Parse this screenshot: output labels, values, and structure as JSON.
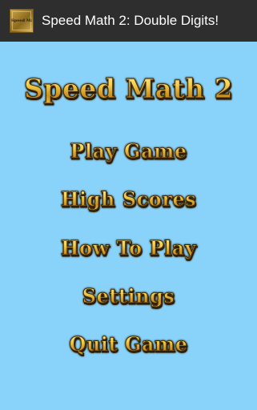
{
  "window": {
    "title": "Speed Math 2: Double Digits!",
    "icon_name": "app-icon",
    "icon_label": "Speed Math 2"
  },
  "screen": {
    "title": "Speed Math 2",
    "background_color": "#89d3fb",
    "text_color": "#f7c52c"
  },
  "menu": {
    "items": [
      {
        "label": "Play Game"
      },
      {
        "label": "High Scores"
      },
      {
        "label": "How To Play"
      },
      {
        "label": "Settings"
      },
      {
        "label": "Quit Game"
      }
    ]
  }
}
